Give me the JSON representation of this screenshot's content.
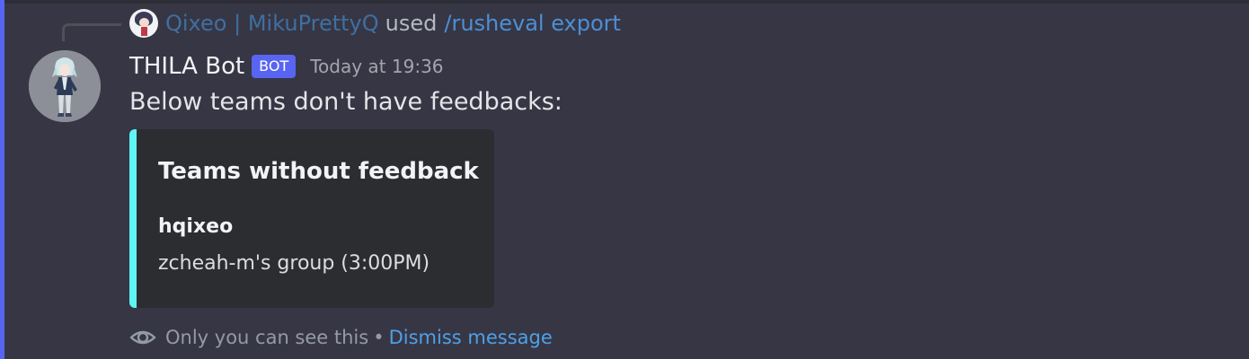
{
  "reply": {
    "username": "Qixeo | MikuPrettyQ",
    "action": "used",
    "command": "/rusheval export"
  },
  "message": {
    "author": "THILA Bot",
    "bot_tag": "BOT",
    "timestamp": "Today at 19:36",
    "content": "Below teams don't have feedbacks:"
  },
  "embed": {
    "accent_color": "#5ff5f5",
    "title": "Teams without feedback",
    "fields": [
      {
        "name": "hqixeo",
        "value": "zcheah-m's group (3:00PM)"
      }
    ]
  },
  "ephemeral_note": {
    "icon": "eye-icon",
    "text": "Only you can see this",
    "separator": "•",
    "dismiss_label": "Dismiss message"
  },
  "colors": {
    "background": "#373645",
    "bot_tag": "#5865f2",
    "link": "#4ea0e8",
    "mention_bar": "#5865f2"
  }
}
